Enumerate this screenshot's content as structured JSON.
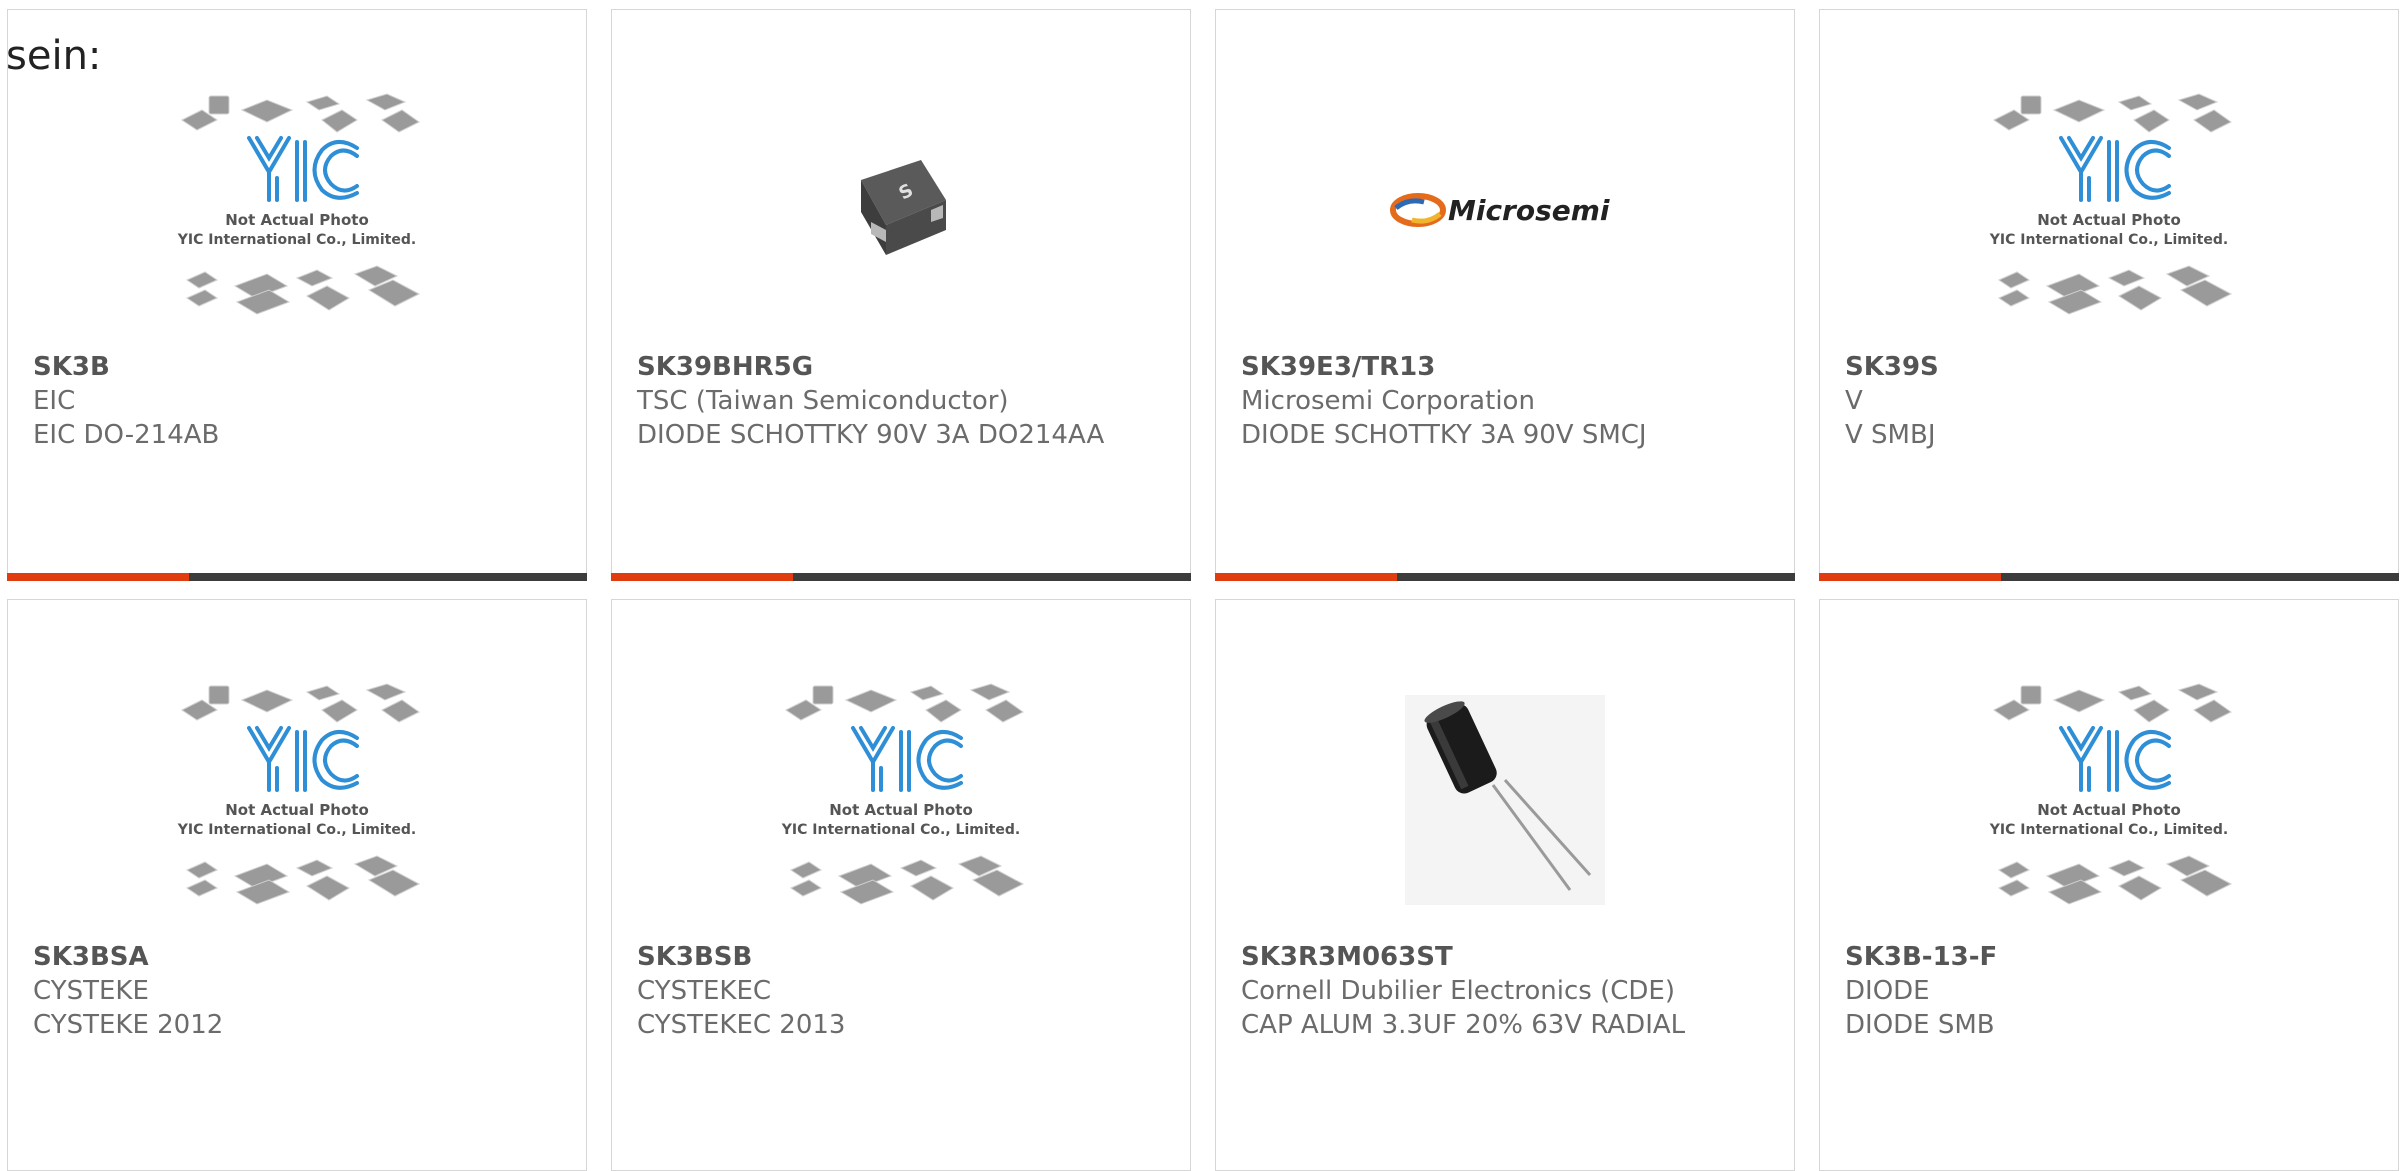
{
  "heading": "sein:",
  "colors": {
    "accent_red": "#e03c10",
    "accent_dark": "#3c3c3c",
    "yic_blue": "#2e8fd6",
    "card_border": "#d6d6d6"
  },
  "placeholder": {
    "line1": "Not Actual Photo",
    "line2": "YIC International Co., Limited."
  },
  "microsemi_logo_text": "Microsemi",
  "products": [
    {
      "part": "SK3B",
      "manufacturer": "EIC",
      "description": "EIC DO-214AB",
      "image": "yic-placeholder"
    },
    {
      "part": "SK39BHR5G",
      "manufacturer": "TSC (Taiwan Semiconductor)",
      "description": "DIODE SCHOTTKY 90V 3A DO214AA",
      "image": "smd-diode"
    },
    {
      "part": "SK39E3/TR13",
      "manufacturer": "Microsemi Corporation",
      "description": "DIODE SCHOTTKY 3A 90V SMCJ",
      "image": "microsemi-logo"
    },
    {
      "part": "SK39S",
      "manufacturer": "V",
      "description": "V SMBJ",
      "image": "yic-placeholder"
    },
    {
      "part": "SK3BSA",
      "manufacturer": "CYSTEKE",
      "description": "CYSTEKE 2012",
      "image": "yic-placeholder"
    },
    {
      "part": "SK3BSB",
      "manufacturer": "CYSTEKEC",
      "description": "CYSTEKEC 2013",
      "image": "yic-placeholder"
    },
    {
      "part": "SK3R3M063ST",
      "manufacturer": "Cornell Dubilier Electronics (CDE)",
      "description": "CAP ALUM 3.3UF 20% 63V RADIAL",
      "image": "capacitor"
    },
    {
      "part": "SK3B-13-F",
      "manufacturer": "DIODE",
      "description": "DIODE SMB",
      "image": "yic-placeholder"
    }
  ]
}
